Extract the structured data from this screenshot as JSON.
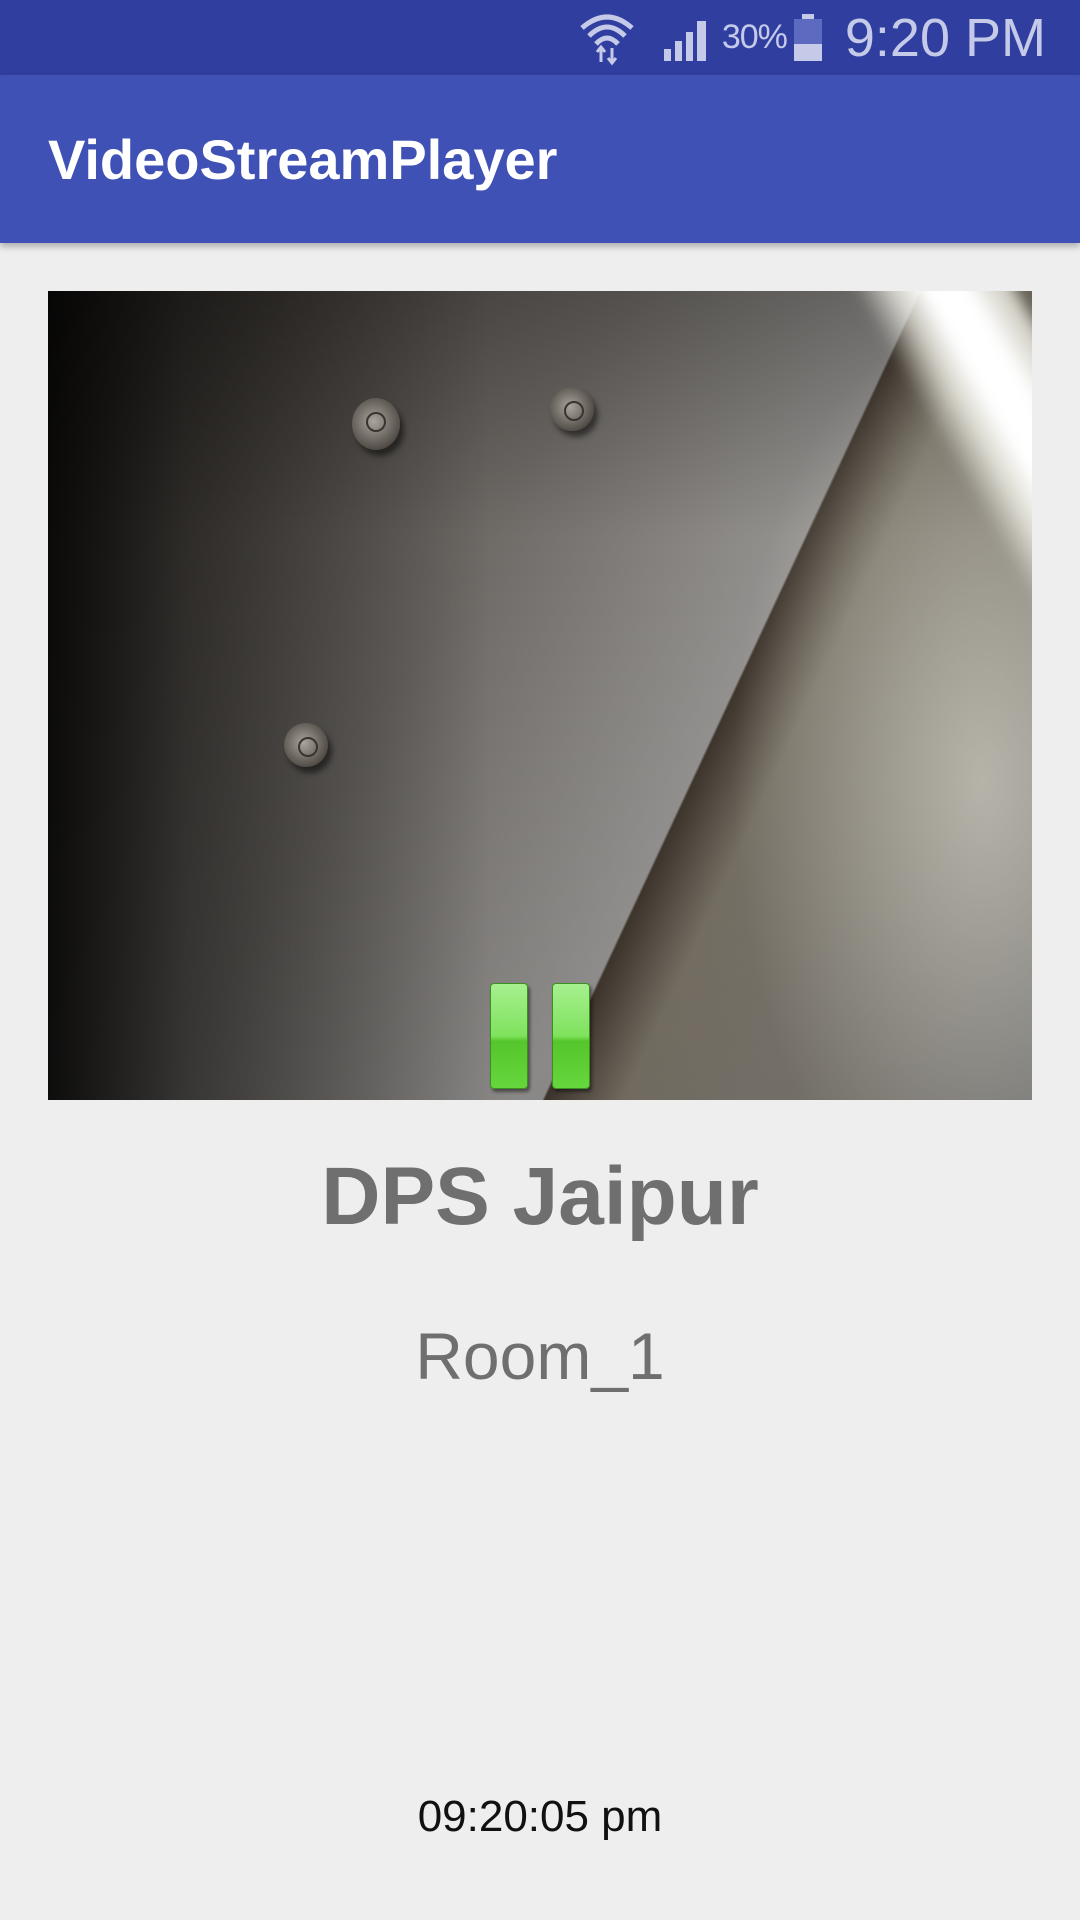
{
  "status_bar": {
    "battery_percent": "30%",
    "time": "9:20 PM",
    "icons": [
      "wifi-icon",
      "signal-icon",
      "battery-icon"
    ],
    "color": "#303f9f"
  },
  "app_bar": {
    "title": "VideoStreamPlayer",
    "color": "#3f51b5"
  },
  "video": {
    "control_icon": "pause-icon",
    "control_state": "playing",
    "control_color": "#7fe25d"
  },
  "info": {
    "school": "DPS Jaipur",
    "room": "Room_1",
    "timestamp": "09:20:05 pm"
  }
}
